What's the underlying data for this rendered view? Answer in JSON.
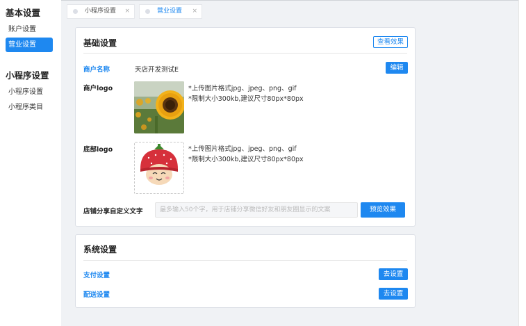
{
  "sidebar": {
    "groups": [
      {
        "title": "基本设置",
        "items": [
          {
            "label": "账户设置",
            "active": false
          },
          {
            "label": "营业设置",
            "active": true
          }
        ]
      },
      {
        "title": "小程序设置",
        "items": [
          {
            "label": "小程序设置",
            "active": false
          },
          {
            "label": "小程序类目",
            "active": false
          }
        ]
      }
    ]
  },
  "tabs": [
    {
      "label": "小程序设置",
      "close": "×",
      "active": false
    },
    {
      "label": "营业设置",
      "close": "×",
      "active": true
    }
  ],
  "basic": {
    "title": "基础设置",
    "view_effect": "查看效果",
    "merchant_name_label": "商户名称",
    "merchant_name_value": "天店开发测试E",
    "edit_button": "编辑",
    "merchant_logo_label": "商户logo",
    "logo_hint_1": "*上传图片格式jpg、jpeg、png、gif",
    "logo_hint_2": "*限制大小300kb,建议尺寸80px*80px",
    "bottom_logo_label": "底部logo",
    "bottom_hint_1": "*上传图片格式jpg、jpeg、png、gif",
    "bottom_hint_2": "*限制大小300kb,建议尺寸80px*80px",
    "share_label": "店铺分享自定义文字",
    "share_placeholder": "最多输入50个字，用于店铺分享微信好友和朋友圈显示的文案",
    "preview_button": "预览效果"
  },
  "system": {
    "title": "系统设置",
    "payment_label": "支付设置",
    "payment_button": "去设置",
    "delivery_label": "配送设置",
    "delivery_button": "去设置"
  },
  "colors": {
    "accent": "#1e88f0",
    "background": "#f0f2f5"
  }
}
